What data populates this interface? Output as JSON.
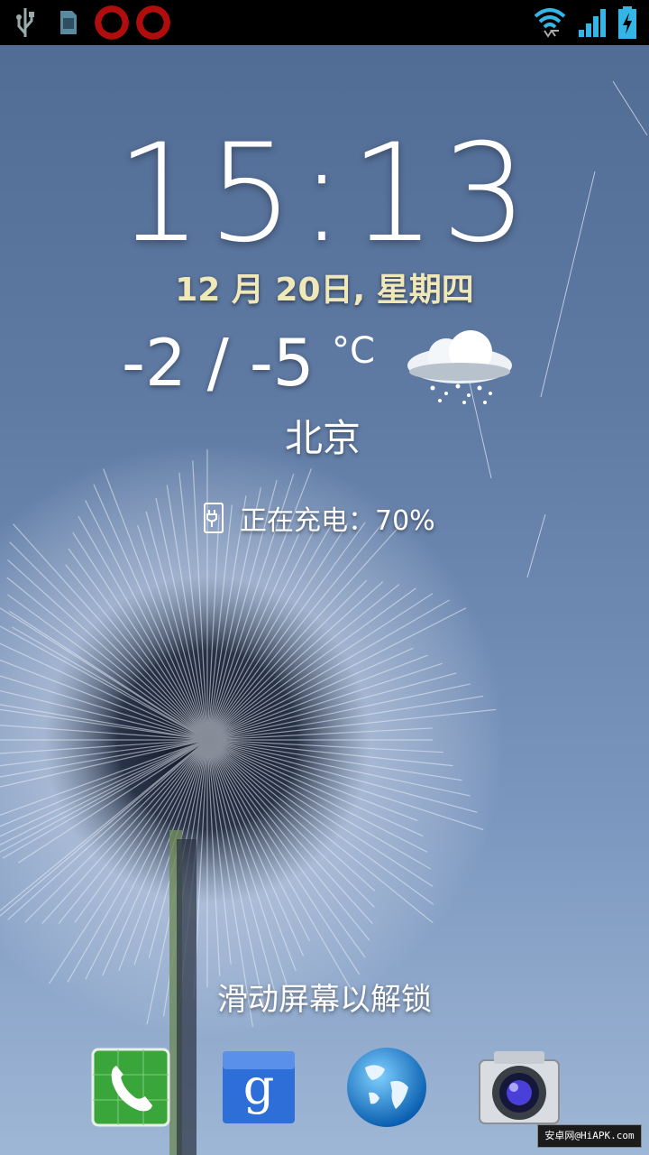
{
  "lockscreen": {
    "time": "15:13",
    "date": "12 月 20日, 星期四",
    "weather": {
      "temperature": "-2 / -5",
      "unit": "°C",
      "city": "北京",
      "condition_icon": "snow-cloud-icon"
    },
    "charging_status": "正在充电：70%",
    "unlock_hint": "滑动屏幕以解锁",
    "shortcuts": [
      {
        "name": "phone",
        "icon": "phone-icon"
      },
      {
        "name": "google-search",
        "icon": "google-icon"
      },
      {
        "name": "browser",
        "icon": "globe-icon"
      },
      {
        "name": "camera",
        "icon": "camera-icon"
      }
    ]
  },
  "status_bar": {
    "left_icons": [
      "usb-icon",
      "sd-card-icon",
      "opera-icon",
      "opera-icon"
    ],
    "right_icons": [
      "wifi-icon",
      "signal-icon",
      "battery-charging-icon"
    ]
  },
  "watermark": "安卓网@HiAPK.com",
  "colors": {
    "date_text": "#f0e8b8",
    "status_icons": "#33b5e5",
    "opera_red": "#b10d0d"
  }
}
